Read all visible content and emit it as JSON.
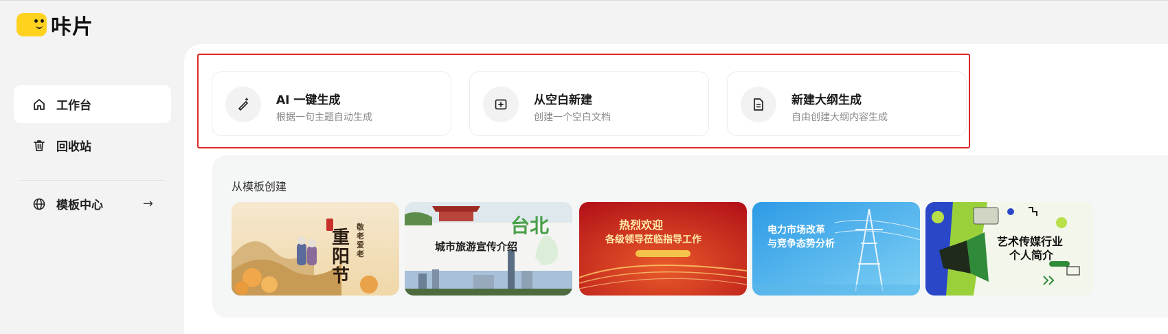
{
  "app": {
    "logo_text": "咔片"
  },
  "sidebar": {
    "items": [
      {
        "label": "工作台",
        "icon": "home-icon",
        "active": true
      },
      {
        "label": "回收站",
        "icon": "trash-icon",
        "active": false
      },
      {
        "label": "模板中心",
        "icon": "globe-icon",
        "active": false,
        "trailing_icon": "arrow-right-icon"
      }
    ]
  },
  "actions": [
    {
      "title": "AI 一键生成",
      "subtitle": "根据一句主题自动生成",
      "icon": "magic-wand-icon"
    },
    {
      "title": "从空白新建",
      "subtitle": "创建一个空白文档",
      "icon": "plus-square-icon"
    },
    {
      "title": "新建大纲生成",
      "subtitle": "自由创建大纲内容生成",
      "icon": "document-icon"
    }
  ],
  "templates_section": {
    "heading": "从模板创建",
    "templates": [
      {
        "name": "重阳节",
        "side_text": "敬老爱老",
        "theme": "double-ninth-festival"
      },
      {
        "name": "城市旅游宣传介绍",
        "accent_text": "台北",
        "theme": "city-tourism"
      },
      {
        "name": "热烈欢迎",
        "line2": "各级领导莅临指导工作",
        "theme": "welcome-banner"
      },
      {
        "name": "电力市场改革",
        "line2": "与竞争态势分析",
        "theme": "power-market"
      },
      {
        "name": "艺术传媒行业",
        "line2": "个人简介",
        "theme": "art-media"
      }
    ]
  },
  "colors": {
    "highlight_border": "#e0262a",
    "logo_yellow": "#ffd21e"
  }
}
